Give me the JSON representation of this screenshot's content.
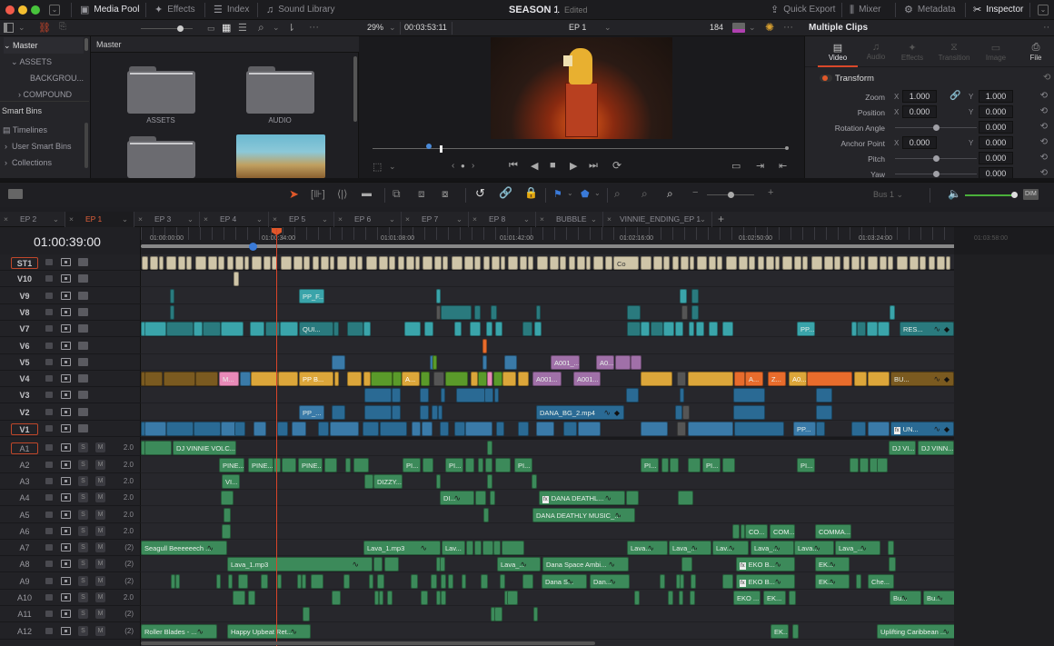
{
  "topbar": {
    "title": "SEASON 1",
    "status": "Edited",
    "left_buttons": [
      {
        "label": "Media Pool",
        "icon": "media-pool-icon",
        "active": true
      },
      {
        "label": "Effects",
        "icon": "effects-wand-icon",
        "active": false
      },
      {
        "label": "Index",
        "icon": "list-index-icon",
        "active": false
      },
      {
        "label": "Sound Library",
        "icon": "sound-library-icon",
        "active": false
      }
    ],
    "right_buttons": [
      {
        "label": "Quick Export",
        "icon": "export-icon",
        "active": false
      },
      {
        "label": "Mixer",
        "icon": "mixer-icon",
        "active": false
      },
      {
        "label": "Metadata",
        "icon": "metadata-icon",
        "active": false
      },
      {
        "label": "Inspector",
        "icon": "inspector-icon",
        "active": true
      }
    ]
  },
  "viewer": {
    "zoom": "29%",
    "source_timecode": "00:03:53:11",
    "timeline_name": "EP 1",
    "frame_count": "184",
    "scrub_progress": 0.17
  },
  "media_pool": {
    "tree": {
      "root": "Master",
      "items": [
        "ASSETS",
        "BACKGROU...",
        "COMPOUND"
      ]
    },
    "smart_bins_title": "Smart Bins",
    "smart_bins": [
      "Timelines",
      "User Smart Bins",
      "Collections"
    ],
    "breadcrumb": "Master",
    "folders": [
      {
        "label": "ASSETS"
      },
      {
        "label": "AUDIO"
      }
    ]
  },
  "inspector": {
    "title": "Multiple Clips",
    "tabs": [
      {
        "label": "Video",
        "active": true
      },
      {
        "label": "Audio",
        "active": false
      },
      {
        "label": "Effects",
        "active": false
      },
      {
        "label": "Transition",
        "active": false
      },
      {
        "label": "Image",
        "active": false
      },
      {
        "label": "File",
        "active": false
      }
    ],
    "section": "Transform",
    "params": [
      {
        "label": "Zoom",
        "x": "1.000",
        "y": "1.000",
        "linked": true
      },
      {
        "label": "Position",
        "x": "0.000",
        "y": "0.000"
      },
      {
        "label": "Rotation Angle",
        "value": "0.000",
        "slider": 0.5
      },
      {
        "label": "Anchor Point",
        "x": "0.000",
        "y": "0.000"
      },
      {
        "label": "Pitch",
        "value": "0.000",
        "slider": 0.5
      },
      {
        "label": "Yaw",
        "value": "0.000",
        "slider": 0.5
      }
    ],
    "axis_x": "X",
    "axis_y": "Y"
  },
  "timeline_toolbar": {
    "bus": "Bus 1",
    "dim": "DIM",
    "volume_level": 1.0,
    "zoom_level": 0.5
  },
  "timeline_tabs": [
    {
      "label": "EP 2",
      "active": false
    },
    {
      "label": "EP 1",
      "active": true
    },
    {
      "label": "EP 3",
      "active": false
    },
    {
      "label": "EP 4",
      "active": false
    },
    {
      "label": "EP 5",
      "active": false
    },
    {
      "label": "EP 6",
      "active": false
    },
    {
      "label": "EP 7",
      "active": false
    },
    {
      "label": "EP 8",
      "active": false
    },
    {
      "label": "BUBBLE",
      "active": false
    },
    {
      "label": "VINNIE_ENDING_EP 1",
      "active": false
    }
  ],
  "timeline": {
    "current_timecode": "01:00:39:00",
    "ruler_labels": [
      "01:00:00:00",
      "01:00:34:00",
      "01:01:08:00",
      "01:01:42:00",
      "01:02:16:00",
      "01:02:50:00",
      "01:03:24:00",
      "01:03:58:00"
    ],
    "video_tracks": [
      {
        "name": "ST1",
        "selected": true
      },
      {
        "name": "V10"
      },
      {
        "name": "V9"
      },
      {
        "name": "V8"
      },
      {
        "name": "V7"
      },
      {
        "name": "V6"
      },
      {
        "name": "V5"
      },
      {
        "name": "V4"
      },
      {
        "name": "V3"
      },
      {
        "name": "V2"
      },
      {
        "name": "V1",
        "selected": true
      }
    ],
    "audio_tracks": [
      {
        "name": "A1",
        "selected": true,
        "vol": "2.0"
      },
      {
        "name": "A2",
        "vol": "2.0"
      },
      {
        "name": "A3",
        "vol": "2.0"
      },
      {
        "name": "A4",
        "vol": "2.0"
      },
      {
        "name": "A5",
        "vol": "2.0"
      },
      {
        "name": "A6",
        "vol": "2.0"
      },
      {
        "name": "A7",
        "vol": "(2)"
      },
      {
        "name": "A8",
        "vol": "(2)"
      },
      {
        "name": "A9",
        "vol": "(2)"
      },
      {
        "name": "A10",
        "vol": "2.0"
      },
      {
        "name": "A11",
        "vol": "(2)"
      },
      {
        "name": "A12",
        "vol": "(2)"
      }
    ],
    "solo_label": "S",
    "mute_label": "M",
    "clip_labels": {
      "st1": "Co",
      "v9": "PP_F...",
      "v7a": "QUI...",
      "v7b": "PP...",
      "v7c": "RES...",
      "v5a": "A001_...",
      "v5b": "A0...",
      "v4a": "M...",
      "v4b": "PP B...",
      "v4c": "A...",
      "v4d": "A001...",
      "v4e": "A001...",
      "v4f": "A...",
      "v4g": "Z...",
      "v4h": "A0...",
      "v4i": "BU...",
      "v2a": "PP_...",
      "v2b": "DANA_BG_2.mp4",
      "v1a": "PP...",
      "v1b": "UN...",
      "a1a": "DJ VINNIE VOLC...",
      "a1b": "DJ VI...",
      "a1c": "DJ VINN...",
      "a2a": "PINE...",
      "a2b": "PINE...",
      "a2c": "PINE...",
      "a2d": "PI...",
      "a2e": "PI...",
      "a2f": "PI...",
      "a2g": "PI...",
      "a2h": "PI...",
      "a2i": "PI...",
      "a3a": "VI...",
      "a3b": "DIZZY...",
      "a4a": "DI...",
      "a4b": "DANA DEATHL...",
      "a5a": "DANA DEATHLY MUSIC_...",
      "a6a": "CO...",
      "a6b": "COM...",
      "a6c": "COMMA...",
      "a7a": "Seagull Beeeeeech ...",
      "a7b": "Lava_1.mp3",
      "a7c": "Lav...",
      "a7d": "Lava...",
      "a7e": "Lava_...",
      "a7f": "Lav...",
      "a7g": "Lava_...",
      "a7h": "Lava...",
      "a7i": "Lava_...",
      "a8a": "Lava_1.mp3",
      "a8b": "Lava_...",
      "a8c": "Dana Space Ambi...",
      "a8d": "EKO B...",
      "a8e": "EK...",
      "a9a": "Dana S...",
      "a9b": "Dan...",
      "a9c": "EKO B...",
      "a9d": "EK...",
      "a9e": "Che...",
      "a10a": "EKO ...",
      "a10b": "EK...",
      "a10c": "Bu...",
      "a10d": "Bu...",
      "a12a": "Roller Blades - ...",
      "a12b": "Happy Upbeat Ret...",
      "a12c": "EK...",
      "a12d": "Uplifting Caribbean ..."
    }
  },
  "colors": {
    "accent": "#e0603a",
    "playhead": "#d8452a",
    "audio_clip": "#3c8a5a",
    "video_blue": "#2a6a94",
    "video_teal": "#3aa4aa",
    "video_yellow": "#dca63a"
  }
}
